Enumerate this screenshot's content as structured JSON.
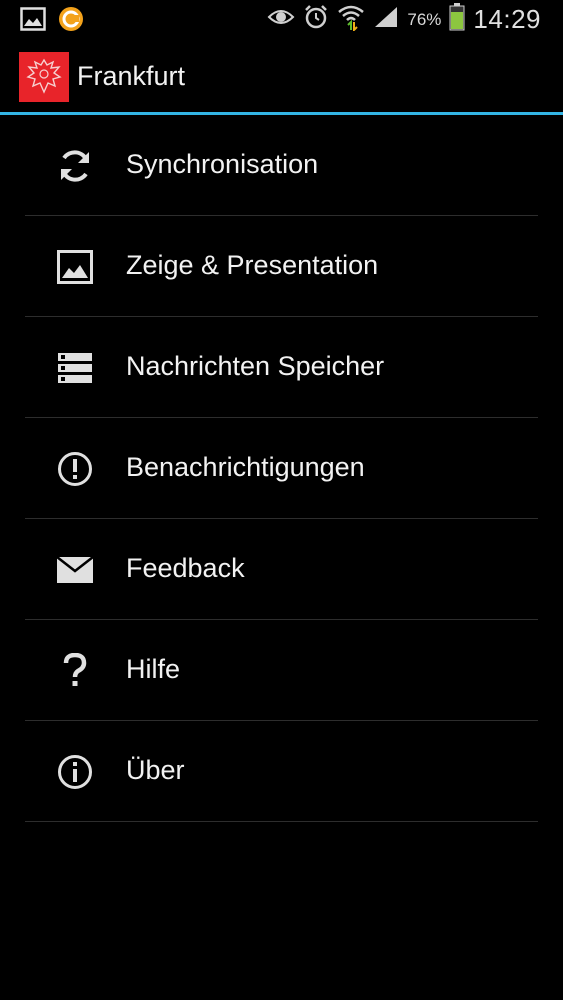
{
  "status_bar": {
    "left_icons": [
      "gallery-icon",
      "orange-circle-icon"
    ],
    "right_icons": [
      "eye-icon",
      "alarm-icon",
      "wifi-icon",
      "signal-icon",
      "battery-icon"
    ],
    "battery_percent": "76%",
    "time": "14:29"
  },
  "action_bar": {
    "title": "Frankfurt",
    "logo": "frankfurt-eagle-logo",
    "accent_color": "#33b5e5",
    "logo_color": "#e8242a"
  },
  "menu": {
    "items": [
      {
        "label": "Synchronisation",
        "icon": "sync-icon"
      },
      {
        "label": "Zeige & Presentation",
        "icon": "image-icon"
      },
      {
        "label": "Nachrichten Speicher",
        "icon": "storage-icon"
      },
      {
        "label": "Benachrichtigungen",
        "icon": "alert-icon"
      },
      {
        "label": "Feedback",
        "icon": "mail-icon"
      },
      {
        "label": "Hilfe",
        "icon": "help-icon"
      },
      {
        "label": "Über",
        "icon": "info-icon"
      }
    ]
  }
}
